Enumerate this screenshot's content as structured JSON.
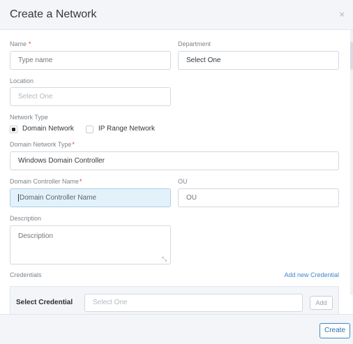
{
  "dialog": {
    "title": "Create a Network",
    "close_glyph": "×"
  },
  "form": {
    "name": {
      "label": "Name",
      "required_mark": "*",
      "placeholder": "Type name"
    },
    "department": {
      "label": "Department",
      "value": "Select One"
    },
    "location": {
      "label": "Location",
      "placeholder": "Select One"
    },
    "network_type": {
      "label": "Network Type",
      "options": [
        {
          "label": "Domain Network",
          "checked": true
        },
        {
          "label": "IP Range Network",
          "checked": false
        }
      ]
    },
    "domain_network_type": {
      "label": "Domain Network Type",
      "required_mark": "*",
      "value": "Windows Domain Controller"
    },
    "domain_controller_name": {
      "label": "Domain Controller Name",
      "required_mark": "*",
      "placeholder": "Domain Controller Name"
    },
    "ou": {
      "label": "OU",
      "placeholder": "OU"
    },
    "description": {
      "label": "Description",
      "placeholder": "Description"
    },
    "credentials": {
      "label": "Credentials",
      "add_link": "Add new Credential",
      "select_label": "Select Credential",
      "select_placeholder": "Select One",
      "add_button": "Add"
    }
  },
  "footer": {
    "create_button": "Create"
  },
  "colors": {
    "accent": "#3f86c7",
    "required": "#e53935",
    "focus_bg": "#e3f1fb"
  }
}
